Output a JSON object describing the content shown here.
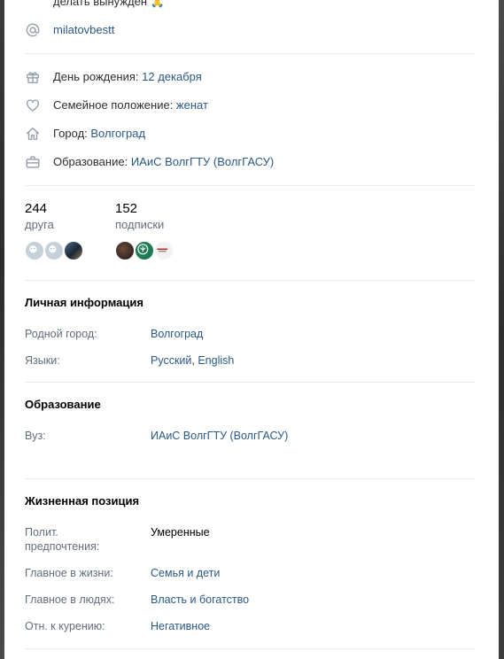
{
  "top_text": "делать вынужден 🙏",
  "nickname": "milatovbestt",
  "details": {
    "birthday_label": "День рождения: ",
    "birthday_value": "12 декабря",
    "family_label": "Семейное положение: ",
    "family_value": "женат",
    "city_label": "Город: ",
    "city_value": "Волгоград",
    "education_label": "Образование: ",
    "education_value": "ИАиС ВолгГТУ (ВолгГАСУ)"
  },
  "counters": {
    "friends_count": "244",
    "friends_label": "друга",
    "subs_count": "152",
    "subs_label": "подписки"
  },
  "personal": {
    "title": "Личная информация",
    "hometown_label": "Родной город:",
    "hometown_value": "Волгоград",
    "languages_label": "Языки:",
    "lang1": "Русский",
    "lang_sep": ", ",
    "lang2": "English"
  },
  "education": {
    "title": "Образование",
    "university_label": "Вуз:",
    "university_value": "ИАиС ВолгГТУ (ВолгГАСУ)"
  },
  "life": {
    "title": "Жизненная позиция",
    "political_label_1": "Полит.",
    "political_label_2": "предпочтения:",
    "political_value": "Умеренные",
    "life_main_label": "Главное в жизни:",
    "life_main_value": "Семья и дети",
    "people_main_label": "Главное в людях:",
    "people_main_value": "Власть и богатство",
    "smoking_label": "Отн. к курению:",
    "smoking_value": "Негативное"
  },
  "colors": {
    "link": "#2a5885",
    "muted": "#626d7a",
    "icon": "#99a2ad",
    "divider": "#e7e8ec"
  }
}
